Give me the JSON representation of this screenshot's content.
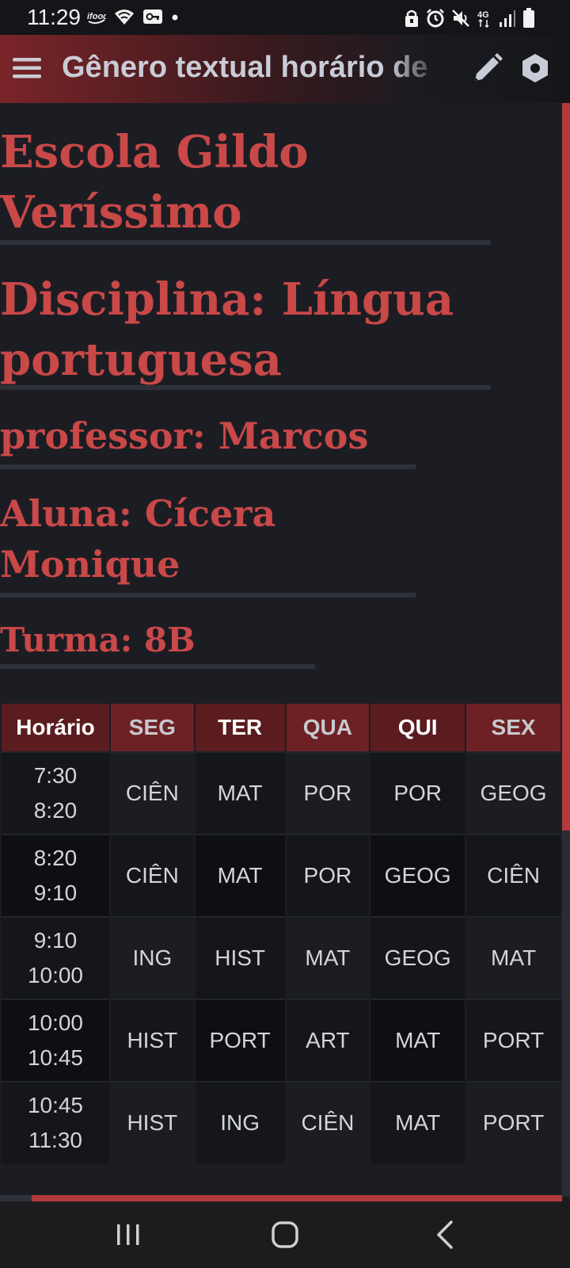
{
  "status_bar": {
    "time": "11:29",
    "left_icons": [
      "ifood-notification-icon",
      "wifi-icon",
      "vpn-key-icon",
      "dot-icon"
    ],
    "right_icons": [
      "lock-icon",
      "alarm-icon",
      "mute-icon",
      "4g-icon",
      "signal-icon",
      "battery-icon"
    ],
    "network": "4G"
  },
  "app_bar": {
    "title": "Gênero textual horário de",
    "menu_icon": "hamburger-menu-icon",
    "edit_icon": "pencil-edit-icon",
    "settings_icon": "hexagon-settings-icon"
  },
  "content": {
    "school": "Escola Gildo Veríssimo",
    "subject": "Disciplina: Língua portuguesa",
    "teacher": "professor: Marcos",
    "student": "Aluna: Cícera Monique",
    "class": "Turma: 8B"
  },
  "schedule": {
    "headers": [
      "Horário",
      "SEG",
      "TER",
      "QUA",
      "QUI",
      "SEX"
    ],
    "rows": [
      {
        "start": "7:30",
        "end": "8:20",
        "cells": [
          "CIÊN",
          "MAT",
          "POR",
          "POR",
          "GEOG"
        ]
      },
      {
        "start": "8:20",
        "end": "9:10",
        "cells": [
          "CIÊN",
          "MAT",
          "POR",
          "GEOG",
          "CIÊN"
        ]
      },
      {
        "start": "9:10",
        "end": "10:00",
        "cells": [
          "ING",
          "HIST",
          "MAT",
          "GEOG",
          "MAT"
        ]
      },
      {
        "start": "10:00",
        "end": "10:45",
        "cells": [
          "HIST",
          "PORT",
          "ART",
          "MAT",
          "PORT"
        ]
      },
      {
        "start": "10:45",
        "end": "11:30",
        "cells": [
          "HIST",
          "ING",
          "CIÊN",
          "MAT",
          "PORT"
        ]
      }
    ]
  },
  "colors": {
    "accent": "#c94848",
    "header_bg": "#6e2124",
    "background": "#1c1d23"
  },
  "nav_bar": {
    "icons": [
      "recent-apps-icon",
      "home-icon",
      "back-icon"
    ]
  }
}
